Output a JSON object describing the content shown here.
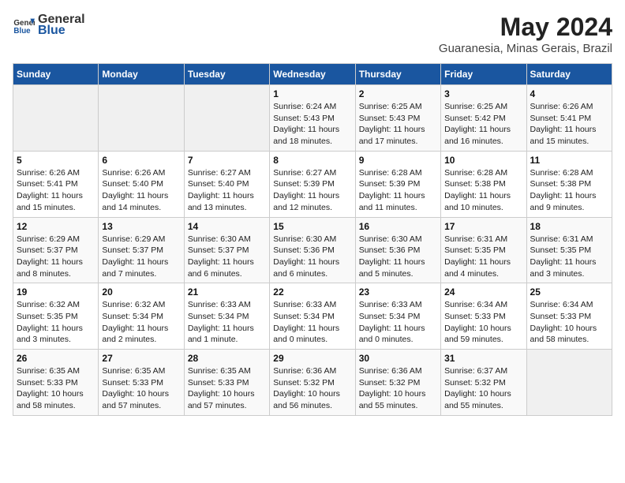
{
  "header": {
    "logo_general": "General",
    "logo_blue": "Blue",
    "title": "May 2024",
    "subtitle": "Guaranesia, Minas Gerais, Brazil"
  },
  "weekdays": [
    "Sunday",
    "Monday",
    "Tuesday",
    "Wednesday",
    "Thursday",
    "Friday",
    "Saturday"
  ],
  "weeks": [
    [
      {
        "day": "",
        "empty": true
      },
      {
        "day": "",
        "empty": true
      },
      {
        "day": "",
        "empty": true
      },
      {
        "day": "1",
        "sunrise": "Sunrise: 6:24 AM",
        "sunset": "Sunset: 5:43 PM",
        "daylight": "Daylight: 11 hours and 18 minutes."
      },
      {
        "day": "2",
        "sunrise": "Sunrise: 6:25 AM",
        "sunset": "Sunset: 5:43 PM",
        "daylight": "Daylight: 11 hours and 17 minutes."
      },
      {
        "day": "3",
        "sunrise": "Sunrise: 6:25 AM",
        "sunset": "Sunset: 5:42 PM",
        "daylight": "Daylight: 11 hours and 16 minutes."
      },
      {
        "day": "4",
        "sunrise": "Sunrise: 6:26 AM",
        "sunset": "Sunset: 5:41 PM",
        "daylight": "Daylight: 11 hours and 15 minutes."
      }
    ],
    [
      {
        "day": "5",
        "sunrise": "Sunrise: 6:26 AM",
        "sunset": "Sunset: 5:41 PM",
        "daylight": "Daylight: 11 hours and 15 minutes."
      },
      {
        "day": "6",
        "sunrise": "Sunrise: 6:26 AM",
        "sunset": "Sunset: 5:40 PM",
        "daylight": "Daylight: 11 hours and 14 minutes."
      },
      {
        "day": "7",
        "sunrise": "Sunrise: 6:27 AM",
        "sunset": "Sunset: 5:40 PM",
        "daylight": "Daylight: 11 hours and 13 minutes."
      },
      {
        "day": "8",
        "sunrise": "Sunrise: 6:27 AM",
        "sunset": "Sunset: 5:39 PM",
        "daylight": "Daylight: 11 hours and 12 minutes."
      },
      {
        "day": "9",
        "sunrise": "Sunrise: 6:28 AM",
        "sunset": "Sunset: 5:39 PM",
        "daylight": "Daylight: 11 hours and 11 minutes."
      },
      {
        "day": "10",
        "sunrise": "Sunrise: 6:28 AM",
        "sunset": "Sunset: 5:38 PM",
        "daylight": "Daylight: 11 hours and 10 minutes."
      },
      {
        "day": "11",
        "sunrise": "Sunrise: 6:28 AM",
        "sunset": "Sunset: 5:38 PM",
        "daylight": "Daylight: 11 hours and 9 minutes."
      }
    ],
    [
      {
        "day": "12",
        "sunrise": "Sunrise: 6:29 AM",
        "sunset": "Sunset: 5:37 PM",
        "daylight": "Daylight: 11 hours and 8 minutes."
      },
      {
        "day": "13",
        "sunrise": "Sunrise: 6:29 AM",
        "sunset": "Sunset: 5:37 PM",
        "daylight": "Daylight: 11 hours and 7 minutes."
      },
      {
        "day": "14",
        "sunrise": "Sunrise: 6:30 AM",
        "sunset": "Sunset: 5:37 PM",
        "daylight": "Daylight: 11 hours and 6 minutes."
      },
      {
        "day": "15",
        "sunrise": "Sunrise: 6:30 AM",
        "sunset": "Sunset: 5:36 PM",
        "daylight": "Daylight: 11 hours and 6 minutes."
      },
      {
        "day": "16",
        "sunrise": "Sunrise: 6:30 AM",
        "sunset": "Sunset: 5:36 PM",
        "daylight": "Daylight: 11 hours and 5 minutes."
      },
      {
        "day": "17",
        "sunrise": "Sunrise: 6:31 AM",
        "sunset": "Sunset: 5:35 PM",
        "daylight": "Daylight: 11 hours and 4 minutes."
      },
      {
        "day": "18",
        "sunrise": "Sunrise: 6:31 AM",
        "sunset": "Sunset: 5:35 PM",
        "daylight": "Daylight: 11 hours and 3 minutes."
      }
    ],
    [
      {
        "day": "19",
        "sunrise": "Sunrise: 6:32 AM",
        "sunset": "Sunset: 5:35 PM",
        "daylight": "Daylight: 11 hours and 3 minutes."
      },
      {
        "day": "20",
        "sunrise": "Sunrise: 6:32 AM",
        "sunset": "Sunset: 5:34 PM",
        "daylight": "Daylight: 11 hours and 2 minutes."
      },
      {
        "day": "21",
        "sunrise": "Sunrise: 6:33 AM",
        "sunset": "Sunset: 5:34 PM",
        "daylight": "Daylight: 11 hours and 1 minute."
      },
      {
        "day": "22",
        "sunrise": "Sunrise: 6:33 AM",
        "sunset": "Sunset: 5:34 PM",
        "daylight": "Daylight: 11 hours and 0 minutes."
      },
      {
        "day": "23",
        "sunrise": "Sunrise: 6:33 AM",
        "sunset": "Sunset: 5:34 PM",
        "daylight": "Daylight: 11 hours and 0 minutes."
      },
      {
        "day": "24",
        "sunrise": "Sunrise: 6:34 AM",
        "sunset": "Sunset: 5:33 PM",
        "daylight": "Daylight: 10 hours and 59 minutes."
      },
      {
        "day": "25",
        "sunrise": "Sunrise: 6:34 AM",
        "sunset": "Sunset: 5:33 PM",
        "daylight": "Daylight: 10 hours and 58 minutes."
      }
    ],
    [
      {
        "day": "26",
        "sunrise": "Sunrise: 6:35 AM",
        "sunset": "Sunset: 5:33 PM",
        "daylight": "Daylight: 10 hours and 58 minutes."
      },
      {
        "day": "27",
        "sunrise": "Sunrise: 6:35 AM",
        "sunset": "Sunset: 5:33 PM",
        "daylight": "Daylight: 10 hours and 57 minutes."
      },
      {
        "day": "28",
        "sunrise": "Sunrise: 6:35 AM",
        "sunset": "Sunset: 5:33 PM",
        "daylight": "Daylight: 10 hours and 57 minutes."
      },
      {
        "day": "29",
        "sunrise": "Sunrise: 6:36 AM",
        "sunset": "Sunset: 5:32 PM",
        "daylight": "Daylight: 10 hours and 56 minutes."
      },
      {
        "day": "30",
        "sunrise": "Sunrise: 6:36 AM",
        "sunset": "Sunset: 5:32 PM",
        "daylight": "Daylight: 10 hours and 55 minutes."
      },
      {
        "day": "31",
        "sunrise": "Sunrise: 6:37 AM",
        "sunset": "Sunset: 5:32 PM",
        "daylight": "Daylight: 10 hours and 55 minutes."
      },
      {
        "day": "",
        "empty": true
      }
    ]
  ]
}
